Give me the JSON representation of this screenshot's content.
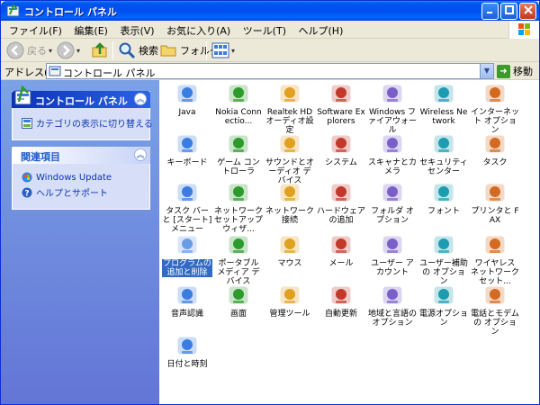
{
  "window": {
    "title": "コントロール パネル",
    "minimize_icon": "minimize-icon",
    "maximize_icon": "maximize-icon",
    "close_icon": "close-icon"
  },
  "menubar": {
    "items": [
      "ファイル(F)",
      "編集(E)",
      "表示(V)",
      "お気に入り(A)",
      "ツール(T)",
      "ヘルプ(H)"
    ]
  },
  "toolbar": {
    "back_label": "戻る",
    "search_label": "検索",
    "folders_label": "フォルダ"
  },
  "address": {
    "label": "アドレス(D)",
    "value": "コントロール パネル",
    "go_label": "移動"
  },
  "left_pane": {
    "control_panel": {
      "title": "コントロール パネル",
      "link": "カテゴリの表示に切り替える"
    },
    "related": {
      "title": "関連項目",
      "links": [
        "Windows Update",
        "ヘルプとサポート"
      ]
    }
  },
  "items": [
    {
      "label": "Java",
      "icon": "java-icon"
    },
    {
      "label": "Nokia Connectio...",
      "icon": "nokia-phone-icon"
    },
    {
      "label": "Realtek HDオーディオ設定",
      "icon": "speaker-icon"
    },
    {
      "label": "Software Explorers",
      "icon": "software-explorer-icon"
    },
    {
      "label": "Windows ファイアウォール",
      "icon": "firewall-icon"
    },
    {
      "label": "Wireless Network",
      "icon": "wireless-icon"
    },
    {
      "label": "インターネット オプション",
      "icon": "internet-options-icon"
    },
    {
      "label": "キーボード",
      "icon": "keyboard-icon"
    },
    {
      "label": "ゲーム コントローラ",
      "icon": "gamepad-icon"
    },
    {
      "label": "サウンドとオーディオ デバイス",
      "icon": "sound-icon"
    },
    {
      "label": "システム",
      "icon": "system-icon"
    },
    {
      "label": "スキャナとカメラ",
      "icon": "scanner-camera-icon"
    },
    {
      "label": "セキュリティ センター",
      "icon": "security-shield-icon"
    },
    {
      "label": "タスク",
      "icon": "scheduled-tasks-icon"
    },
    {
      "label": "タスク バーと [スタート] メニュー",
      "icon": "taskbar-icon"
    },
    {
      "label": "ネットワーク セットアップ ウィザ...",
      "icon": "network-setup-icon"
    },
    {
      "label": "ネットワーク接続",
      "icon": "network-connections-icon"
    },
    {
      "label": "ハードウェアの追加",
      "icon": "add-hardware-icon"
    },
    {
      "label": "フォルダ オプション",
      "icon": "folder-options-icon"
    },
    {
      "label": "フォント",
      "icon": "fonts-folder-icon"
    },
    {
      "label": "プリンタと FAX",
      "icon": "printer-icon"
    },
    {
      "label": "プログラムの追加と削除",
      "icon": "add-remove-programs-icon",
      "selected": true
    },
    {
      "label": "ポータブル メディア デバイス",
      "icon": "portable-media-icon"
    },
    {
      "label": "マウス",
      "icon": "mouse-icon"
    },
    {
      "label": "メール",
      "icon": "mail-icon"
    },
    {
      "label": "ユーザー アカウント",
      "icon": "user-accounts-icon"
    },
    {
      "label": "ユーザー補助の オプション",
      "icon": "accessibility-icon"
    },
    {
      "label": "ワイヤレス ネットワーク セット...",
      "icon": "wireless-setup-icon"
    },
    {
      "label": "音声認識",
      "icon": "speech-icon"
    },
    {
      "label": "画面",
      "icon": "display-icon"
    },
    {
      "label": "管理ツール",
      "icon": "admin-tools-icon"
    },
    {
      "label": "自動更新",
      "icon": "auto-update-icon"
    },
    {
      "label": "地域と言語の オプション",
      "icon": "region-globe-icon"
    },
    {
      "label": "電源オプション",
      "icon": "power-icon"
    },
    {
      "label": "電話とモデムの オプション",
      "icon": "phone-modem-icon"
    },
    {
      "label": "日付と時刻",
      "icon": "date-time-icon"
    }
  ]
}
